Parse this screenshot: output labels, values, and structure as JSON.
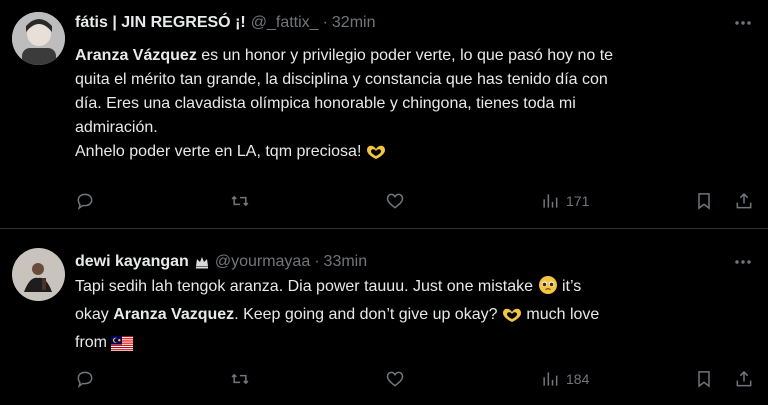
{
  "tweets": [
    {
      "name": "fátis | JIN REGRESÓ ¡!",
      "handle": "@_fattix_",
      "separator": "·",
      "time": "32min",
      "text": {
        "l1_mention": "Aranza Vázquez",
        "l1_rest": " es un honor y privilegio poder verte, lo que pasó hoy no te",
        "l2": "quita el mérito tan grande, la disciplina y constancia que has tenido día con",
        "l3": "día. Eres una clavadista olímpica  honorable y chingona, tienes toda mi",
        "l4": "admiración.",
        "l5": "Anhelo poder verte en LA, tqm preciosa!"
      },
      "views": "171"
    },
    {
      "name": "dewi kayangan",
      "handle": "@yourmayaa",
      "separator": "·",
      "time": "33min",
      "text": {
        "l1a": "Tapi sedih lah tengok aranza. Dia power tauuu. Just one mistake ",
        "l1b": " it’s",
        "l2a": "okay ",
        "l2_mention": "Aranza Vazquez",
        "l2b": ". Keep going and don’t give up okay? ",
        "l2c": " much love",
        "l3": "from "
      },
      "views": "184"
    }
  ],
  "colors": {
    "background": "#000000",
    "text": "#e7e9ea",
    "muted": "#71767b",
    "divider": "#2f3336"
  },
  "icons": [
    "more-icon",
    "reply-icon",
    "retweet-icon",
    "like-icon",
    "views-icon",
    "bookmark-icon",
    "share-icon",
    "heart-hands-emoji",
    "pleading-face-emoji",
    "malaysia-flag-emoji",
    "crown-badge-icon"
  ]
}
